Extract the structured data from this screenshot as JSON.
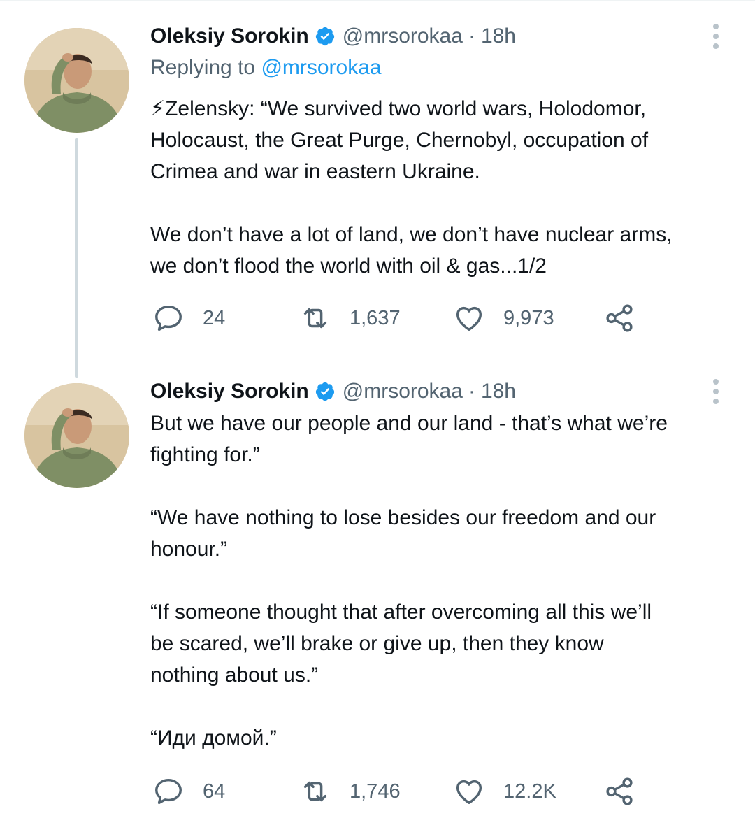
{
  "tweets": [
    {
      "display_name": "Oleksiy Sorokin",
      "handle": "@mrsorokaa",
      "separator": "·",
      "time": "18h",
      "replying_prefix": "Replying to",
      "replying_to": "@mrsorokaa",
      "text_lines": [
        "⚡Zelensky: “We survived two world wars, Holodomor,",
        "Holocaust, the Great Purge, Chernobyl, occupation of",
        "Crimea and war in eastern Ukraine.",
        "We don’t have a lot of land, we don’t have nuclear arms,",
        "we don’t flood the world with oil & gas...1/2"
      ],
      "replies": "24",
      "retweets": "1,637",
      "likes": "9,973"
    },
    {
      "display_name": "Oleksiy Sorokin",
      "handle": "@mrsorokaa",
      "separator": "·",
      "time": "18h",
      "text_lines": [
        "But we have our people and our land - that’s what we’re",
        "fighting for.”",
        "“We have nothing to lose besides our freedom and our",
        "honour.”",
        "“If someone thought that after overcoming all this we’ll",
        "be scared, we’ll brake or give up, then they know",
        "nothing about us.”",
        "“Иди домой.”"
      ],
      "replies": "64",
      "retweets": "1,746",
      "likes": "12.2K"
    }
  ],
  "icons": {
    "avatar": "avatar",
    "verified": "verified-badge-icon",
    "more": "more-options-icon",
    "reply": "reply-icon",
    "retweet": "retweet-icon",
    "like": "heart-icon",
    "share": "share-icon"
  },
  "colors": {
    "text": "#0f1419",
    "secondary": "#536471",
    "accent": "#1d9bf0",
    "thread_line": "#cfd9de",
    "verified": "#1d9bf0"
  }
}
